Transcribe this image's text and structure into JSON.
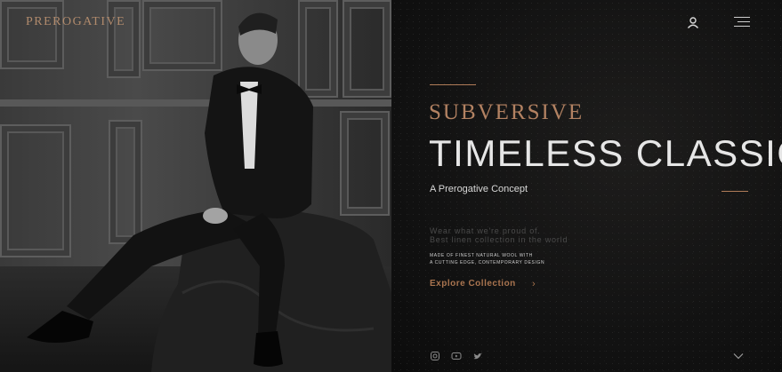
{
  "brand": {
    "logo_text": "PREROGATIVE"
  },
  "hero": {
    "eyebrow": "SUBVERSIVE",
    "headline": "TIMELESS CLASSIC",
    "concept": "A Prerogative Concept",
    "tagline_1": "Wear what we're proud of.",
    "tagline_2": "Best linen collection in the world",
    "detail_1": "MADE OF FINEST NATURAL WOOL WITH",
    "detail_2": "A CUTTING EDGE, CONTEMPORARY DESIGN",
    "cta_label": "Explore Collection",
    "cta_arrow": "›"
  },
  "icons": {
    "account": "user-icon",
    "menu": "hamburger-menu-icon",
    "social": [
      "instagram-icon",
      "youtube-icon",
      "twitter-icon"
    ],
    "scroll": "chevron-down-icon"
  },
  "colors": {
    "accent": "#b07c58",
    "panel_bg": "#121212",
    "headline": "#e6e6e6"
  }
}
